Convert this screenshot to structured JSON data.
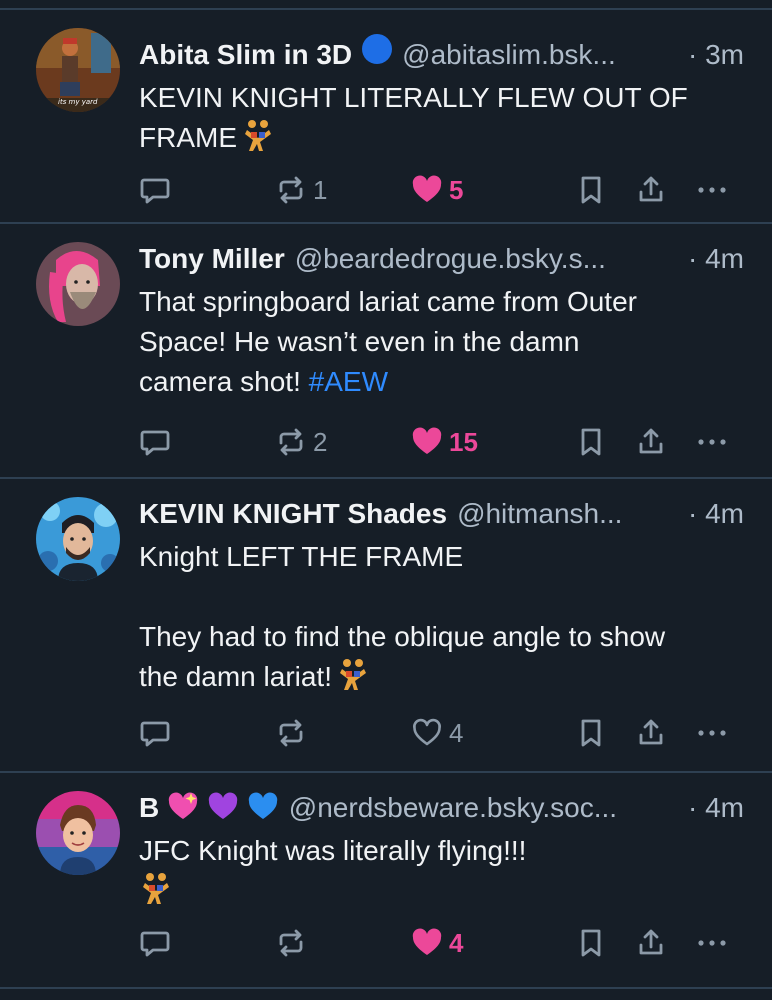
{
  "posts": [
    {
      "name": "Abita Slim in 3D",
      "handle": "@abitaslim.bsk...",
      "time": "· 3m",
      "verified": true,
      "text_lines": [
        "KEVIN KNIGHT LITERALLY FLEW OUT OF",
        "FRAME"
      ],
      "emoji": "wrestlers-emoji",
      "avatar_caption": "its my yard",
      "reply_count": "",
      "repost_count": "1",
      "like_count": "5",
      "liked": true
    },
    {
      "name": "Tony Miller",
      "handle": "@beardedrogue.bsky.s...",
      "time": "· 4m",
      "text_lines": [
        "That springboard lariat came from Outer",
        "Space! He wasn’t even in the damn",
        "camera shot!"
      ],
      "hashtag": "#AEW",
      "reply_count": "",
      "repost_count": "2",
      "like_count": "15",
      "liked": true
    },
    {
      "name": "KEVIN KNIGHT Shades",
      "handle": "@hitmansh...",
      "time": "· 4m",
      "text_lines": [
        "Knight LEFT THE FRAME",
        "",
        "They had to find the oblique angle to show",
        "the damn lariat!"
      ],
      "emoji": "wrestlers-emoji",
      "reply_count": "",
      "repost_count": "",
      "like_count": "4",
      "liked": false
    },
    {
      "name": "B",
      "name_emojis": [
        "sparkling-heart-emoji",
        "purple-heart-emoji",
        "blue-heart-emoji"
      ],
      "handle": "@nerdsbeware.bsky.soc...",
      "time": "· 4m",
      "text_lines": [
        "JFC Knight was literally flying!!!"
      ],
      "emoji": "wrestlers-emoji",
      "reply_count": "",
      "repost_count": "",
      "like_count": "4",
      "liked": true
    }
  ],
  "colors": {
    "background": "#161e27",
    "divider": "#2e4052",
    "text": "#f1f3f5",
    "muted": "#aebbc9",
    "icon": "#8c9aa8",
    "like": "#ec4899",
    "hashtag": "#2f8bff"
  }
}
